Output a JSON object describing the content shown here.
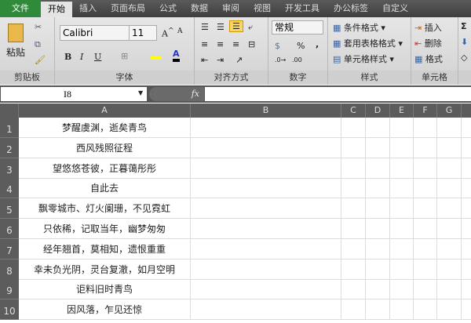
{
  "tabs": [
    "文件",
    "开始",
    "插入",
    "页面布局",
    "公式",
    "数据",
    "审阅",
    "视图",
    "开发工具",
    "办公标签",
    "自定义"
  ],
  "active_tab": "开始",
  "ribbon": {
    "clipboard": {
      "label": "剪贴板",
      "paste": "粘贴"
    },
    "font": {
      "label": "字体",
      "name": "Calibri",
      "size": "11",
      "bold": "B",
      "italic": "I",
      "underline": "U"
    },
    "alignment": {
      "label": "对齐方式"
    },
    "number": {
      "label": "数字",
      "format": "常规",
      "percent": "%",
      "comma": ","
    },
    "styles": {
      "label": "样式",
      "conditional": "条件格式",
      "table": "套用表格格式",
      "cell": "单元格样式"
    },
    "cells": {
      "label": "单元格",
      "insert": "插入",
      "delete": "删除",
      "format": "格式"
    },
    "editing": {
      "sum": "Σ"
    }
  },
  "formula_bar": {
    "name_box": "I8",
    "fx": "fx",
    "value": ""
  },
  "columns": [
    "A",
    "B",
    "C",
    "D",
    "E",
    "F",
    "G"
  ],
  "rows": [
    {
      "n": "1",
      "a": "梦醒虞渊，逝矣青鸟"
    },
    {
      "n": "2",
      "a": "西风残照征程"
    },
    {
      "n": "3",
      "a": "望悠悠苍彼，正暮蔼彤彤"
    },
    {
      "n": "4",
      "a": "自此去"
    },
    {
      "n": "5",
      "a": "飘零城市、灯火阑珊，不见霓虹"
    },
    {
      "n": "6",
      "a": "只依稀，记取当年，幽梦匆匆"
    },
    {
      "n": "7",
      "a": "经年翘首，莫相知，遗恨重重"
    },
    {
      "n": "8",
      "a": "幸未负光阴，灵台复澈，如月空明"
    },
    {
      "n": "9",
      "a": "讵料旧时青鸟"
    },
    {
      "n": "10",
      "a": "因风落，乍见还惊"
    }
  ]
}
